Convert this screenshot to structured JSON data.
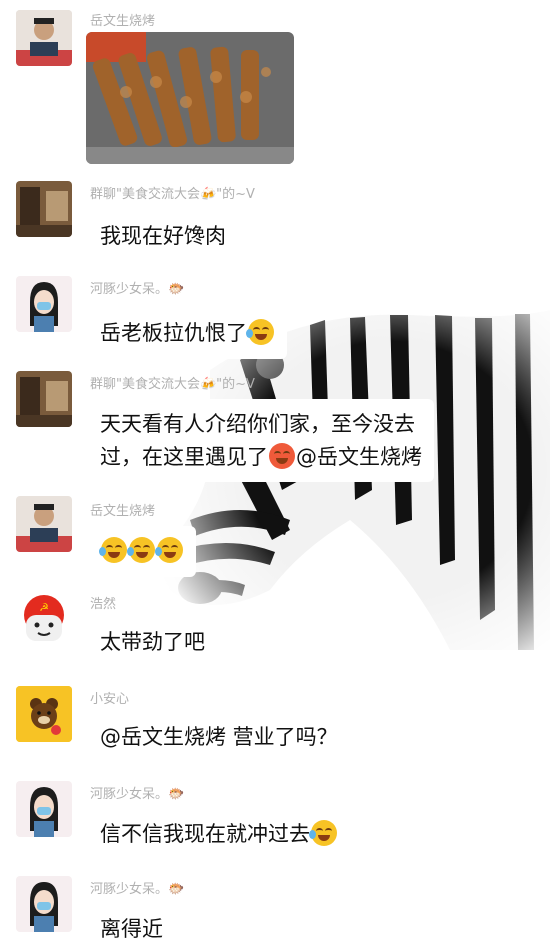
{
  "chat": {
    "messages": [
      {
        "sender": "岳文生烧烤",
        "type": "image",
        "avatar_icon": "man-portrait-avatar"
      },
      {
        "sender": "群聊\"美食交流大会🍻\"的~V",
        "text": "我现在好馋肉",
        "avatar_icon": "room-photo-avatar"
      },
      {
        "sender": "河豚少女呆。🐡",
        "text": "岳老板拉仇恨了",
        "avatar_icon": "girl-drawing-avatar"
      },
      {
        "sender": "群聊\"美食交流大会🍻\"的~V",
        "text_line1": "天天看有人介绍你们家，至今没去",
        "text_line2a": "过，在这里遇见了",
        "text_line2b": "@岳文生烧烤",
        "avatar_icon": "room-photo-avatar"
      },
      {
        "sender": "岳文生烧烤",
        "avatar_icon": "man-portrait-avatar"
      },
      {
        "sender": "浩然",
        "text": "太带劲了吧",
        "avatar_icon": "cartoon-face-avatar"
      },
      {
        "sender": "小安心",
        "text": "@岳文生烧烤  营业了吗？",
        "avatar_icon": "brown-bear-avatar"
      },
      {
        "sender": "河豚少女呆。🐡",
        "text": "信不信我现在就冲过去",
        "avatar_icon": "girl-drawing-avatar"
      },
      {
        "sender": "河豚少女呆。🐡",
        "text": "离得近",
        "avatar_icon": "girl-drawing-avatar"
      }
    ]
  },
  "colors": {
    "background": "#ffffff",
    "sender_name": "#b0b0b0",
    "message_text": "#111111",
    "emoji_yellow": "#f7c325"
  }
}
